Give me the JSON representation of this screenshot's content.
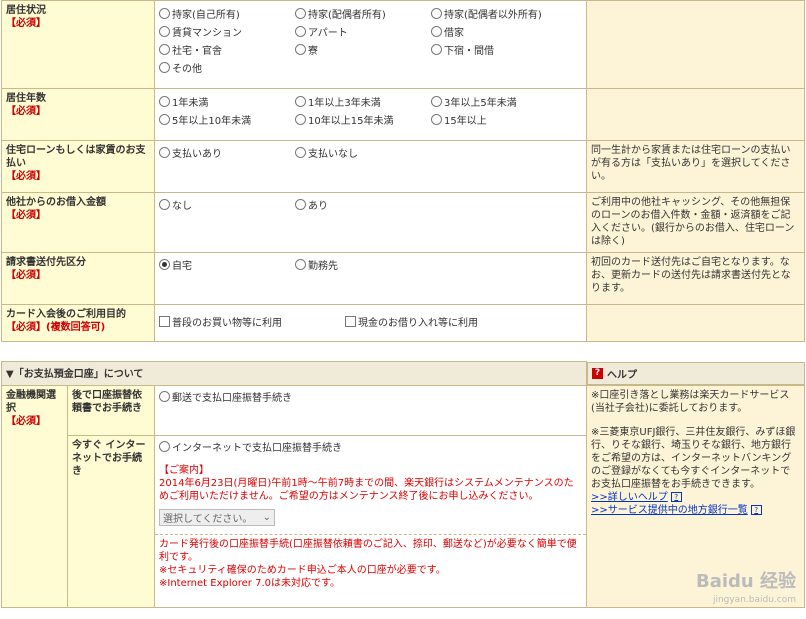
{
  "req": "【必須】",
  "residence": {
    "label": "居住状況",
    "options": [
      "持家(自己所有)",
      "持家(配偶者所有)",
      "持家(配偶者以外所有)",
      "賃貸マンション",
      "アパート",
      "借家",
      "社宅・官舎",
      "寮",
      "下宿・間借",
      "その他"
    ]
  },
  "years": {
    "label": "居住年数",
    "options": [
      "1年未満",
      "1年以上3年未満",
      "3年以上5年未満",
      "5年以上10年未満",
      "10年以上15年未満",
      "15年以上"
    ]
  },
  "loan": {
    "label": "住宅ローンもしくは家賃のお支払い",
    "options": [
      "支払いあり",
      "支払いなし"
    ],
    "help": "同一生計から家賃または住宅ローンの支払いが有る方は「支払いあり」を選択してください。"
  },
  "borrow": {
    "label": "他社からのお借入金額",
    "options": [
      "なし",
      "あり"
    ],
    "help": "ご利用中の他社キャッシング、その他無担保のローンのお借入件数・金額・返済額をご記入ください。(銀行からのお借入、住宅ローンは除く)"
  },
  "billing": {
    "label": "請求書送付先区分",
    "options": [
      "自宅",
      "勤務先"
    ],
    "selected": "自宅",
    "help": "初回のカード送付先はご自宅となります。なお、更新カードの送付先は請求書送付先となります。"
  },
  "purpose": {
    "label": "カード入会後のご利用目的",
    "req": "【必須】(複数回答可)",
    "options": [
      "普段のお買い物等に利用",
      "現金のお借り入れ等に利用"
    ]
  },
  "bank_section": {
    "title": "▼「お支払預金口座」について",
    "help_title": "ヘルプ",
    "help_icon": "?",
    "label": "金融機関選択",
    "later_label": "後で口座振替依頼書でお手続き",
    "later_option": "郵送で支払口座振替手続き",
    "now_label": "今すぐ インターネットでお手続き",
    "now_option": "インターネットで支払口座振替手続き",
    "notice_title": "【ご案内】",
    "notice_text": "2014年6月23日(月曜日)午前1時～午前7時までの間、楽天銀行はシステムメンテナンスのためご利用いただけません。ご希望の方はメンテナンス終了後にお申し込みください。",
    "select_placeholder": "選択してください。",
    "footer_1": "カード発行後の口座振替手続(口座振替依頼書のご記入、捺印、郵送など)が必要なく簡単で便利です。",
    "footer_2": "※セキュリティ確保のためカード申込ご本人の口座が必要です。",
    "footer_3": "※Internet Explorer 7.0は未対応です。",
    "help_1": "※口座引き落とし業務は楽天カードサービス(当社子会社)に委託しております。",
    "help_2": "※三菱東京UFJ銀行、三井住友銀行、みずほ銀行、りそな銀行、埼玉りそな銀行、地方銀行をご希望の方は、インターネットバンキングのご登録がなくても今すぐインターネットでお支払口座振替をお手続きできます。",
    "link_1": ">>詳しいヘルプ",
    "link_2": ">>サービス提供中の地方銀行一覧"
  },
  "watermark": {
    "main": "Baidu 经验",
    "sub": "jingyan.baidu.com"
  }
}
